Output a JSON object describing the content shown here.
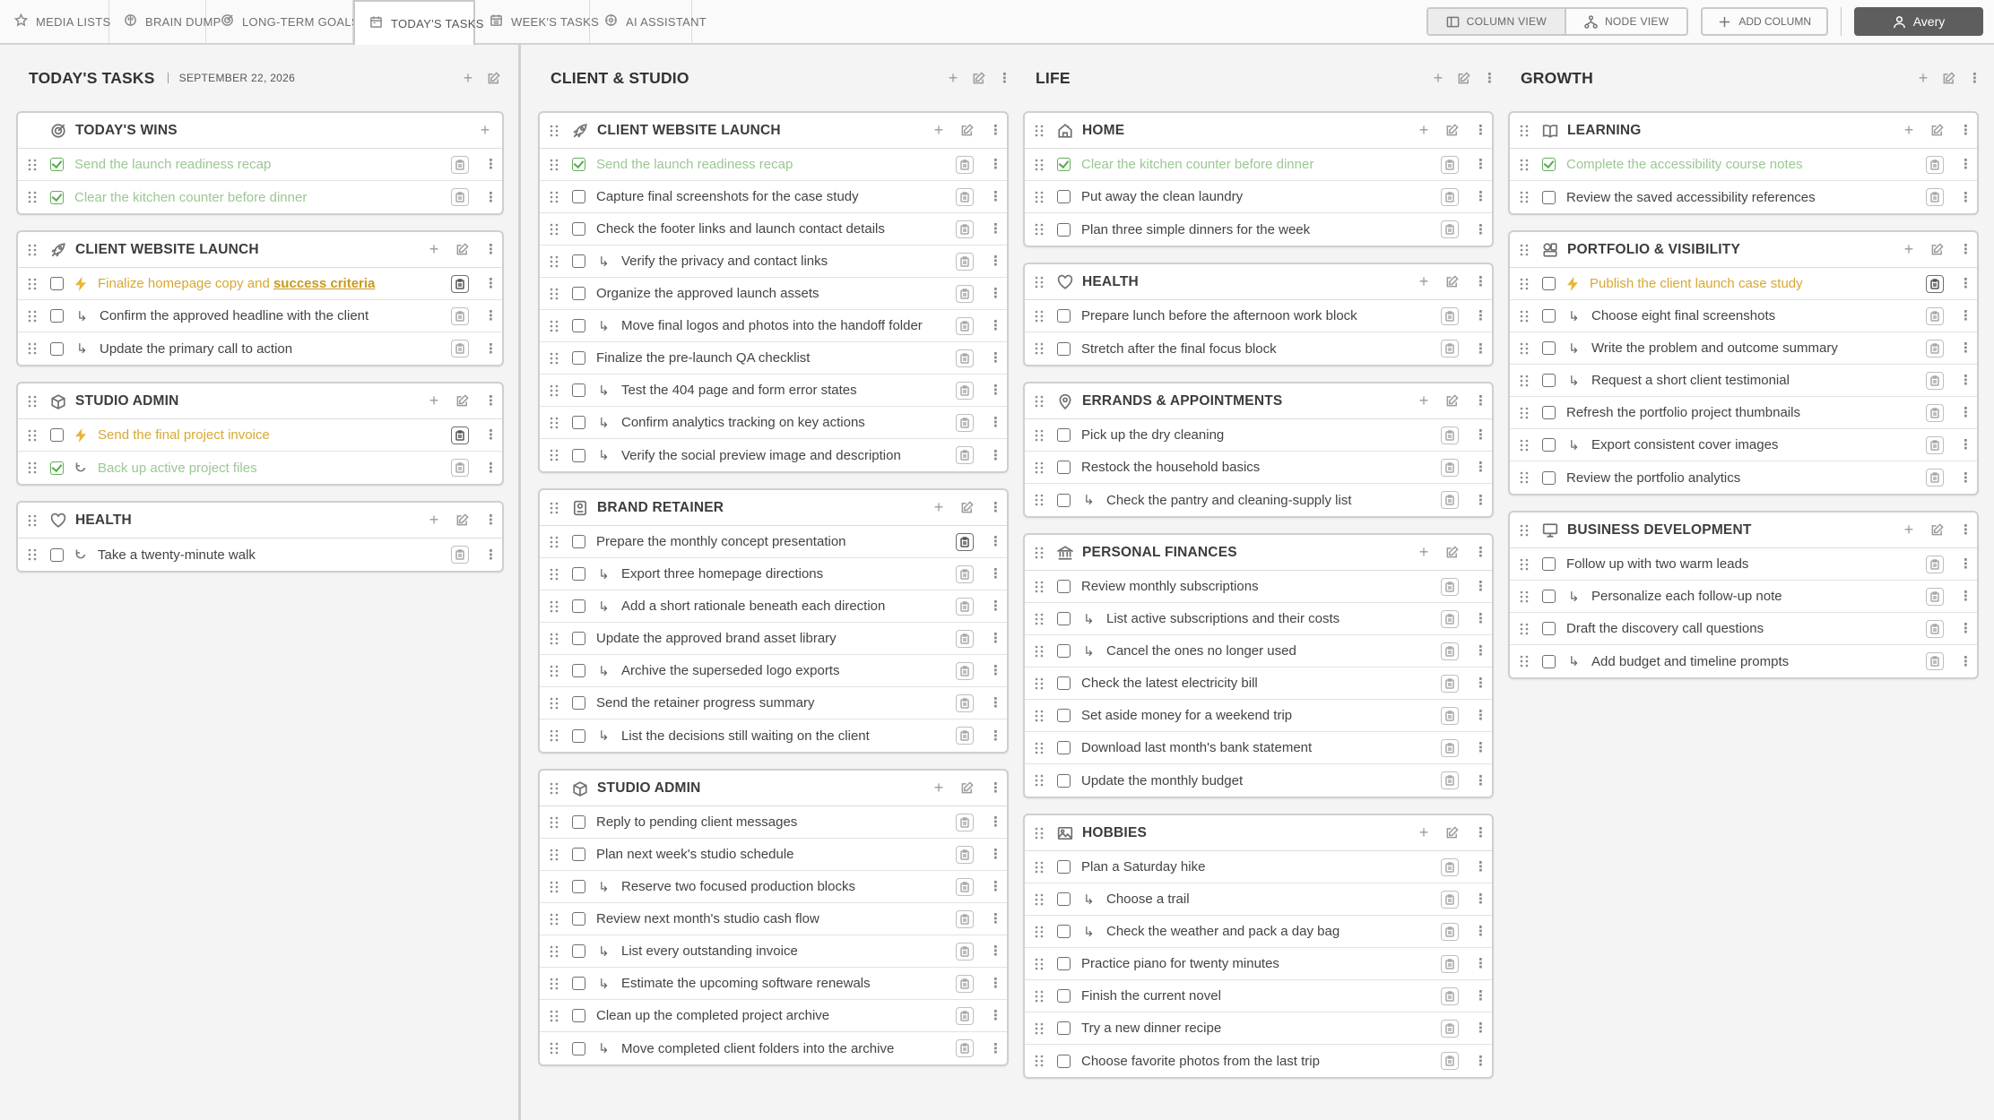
{
  "tabs": [
    {
      "label": "MEDIA LISTS",
      "icon": "star-icon"
    },
    {
      "label": "BRAIN DUMP",
      "icon": "brain-icon"
    },
    {
      "label": "LONG-TERM GOALS",
      "icon": "target-icon"
    },
    {
      "label": "TODAY'S TASKS",
      "icon": "calendar-icon",
      "active": true
    },
    {
      "label": "WEEK'S TASKS",
      "icon": "calendar-week-icon"
    },
    {
      "label": "AI ASSISTANT",
      "icon": "ai-icon"
    }
  ],
  "toolbar": {
    "column_view": "COLUMN VIEW",
    "node_view": "NODE VIEW",
    "add_column": "ADD COLUMN",
    "user": "Avery"
  },
  "colors": {
    "done": "#9bc794",
    "priority": "#d8a833",
    "check": "#5aa851"
  },
  "columns": [
    {
      "title": "TODAY'S TASKS",
      "date": "SEPTEMBER 22, 2026",
      "cards": [
        {
          "title": "TODAY'S WINS",
          "icon": "target-icon",
          "no_grip": true,
          "no_kebab": true,
          "items": [
            {
              "text": "Send the launch readiness recap",
              "done": true
            },
            {
              "text": "Clear the kitchen counter before dinner",
              "done": true
            }
          ]
        },
        {
          "title": "CLIENT WEBSITE LAUNCH",
          "icon": "rocket-icon",
          "items": [
            {
              "text": "Finalize homepage copy and ",
              "emph": "success criteria",
              "priority": true,
              "dark_clip": true
            },
            {
              "text": "Confirm the approved headline with the client",
              "sub": true
            },
            {
              "text": "Update the primary call to action",
              "sub": true
            }
          ]
        },
        {
          "title": "STUDIO ADMIN",
          "icon": "box-icon",
          "items": [
            {
              "text": "Send the final project invoice",
              "priority": true,
              "dark_clip": true
            },
            {
              "text": "Back up active project files",
              "done": true,
              "recurring": true
            }
          ]
        },
        {
          "title": "HEALTH",
          "icon": "heart-icon",
          "items": [
            {
              "text": "Take a twenty-minute walk",
              "recurring": true
            }
          ]
        }
      ]
    },
    {
      "title": "CLIENT & STUDIO",
      "cards": [
        {
          "title": "CLIENT WEBSITE LAUNCH",
          "icon": "rocket-icon",
          "items": [
            {
              "text": "Send the launch readiness recap",
              "done": true
            },
            {
              "text": "Capture final screenshots for the case study"
            },
            {
              "text": "Check the footer links and launch contact details"
            },
            {
              "text": "Verify the privacy and contact links",
              "sub": true
            },
            {
              "text": "Organize the approved launch assets"
            },
            {
              "text": "Move final logos and photos into the handoff folder",
              "sub": true
            },
            {
              "text": "Finalize the pre-launch QA checklist"
            },
            {
              "text": "Test the 404 page and form error states",
              "sub": true
            },
            {
              "text": "Confirm analytics tracking on key actions",
              "sub": true
            },
            {
              "text": "Verify the social preview image and description",
              "sub": true
            }
          ]
        },
        {
          "title": "BRAND RETAINER",
          "icon": "badge-icon",
          "items": [
            {
              "text": "Prepare the monthly concept presentation",
              "dark_clip": true
            },
            {
              "text": "Export three homepage directions",
              "sub": true
            },
            {
              "text": "Add a short rationale beneath each direction",
              "sub": true
            },
            {
              "text": "Update the approved brand asset library"
            },
            {
              "text": "Archive the superseded logo exports",
              "sub": true
            },
            {
              "text": "Send the retainer progress summary"
            },
            {
              "text": "List the decisions still waiting on the client",
              "sub": true
            }
          ]
        },
        {
          "title": "STUDIO ADMIN",
          "icon": "box-icon",
          "items": [
            {
              "text": "Reply to pending client messages"
            },
            {
              "text": "Plan next week's studio schedule"
            },
            {
              "text": "Reserve two focused production blocks",
              "sub": true
            },
            {
              "text": "Review next month's studio cash flow"
            },
            {
              "text": "List every outstanding invoice",
              "sub": true
            },
            {
              "text": "Estimate the upcoming software renewals",
              "sub": true
            },
            {
              "text": "Clean up the completed project archive"
            },
            {
              "text": "Move completed client folders into the archive",
              "sub": true
            }
          ]
        }
      ]
    },
    {
      "title": "LIFE",
      "cards": [
        {
          "title": "HOME",
          "icon": "home-icon",
          "items": [
            {
              "text": "Clear the kitchen counter before dinner",
              "done": true
            },
            {
              "text": "Put away the clean laundry"
            },
            {
              "text": "Plan three simple dinners for the week"
            }
          ]
        },
        {
          "title": "HEALTH",
          "icon": "heart-icon",
          "items": [
            {
              "text": "Prepare lunch before the afternoon work block"
            },
            {
              "text": "Stretch after the final focus block"
            }
          ]
        },
        {
          "title": "ERRANDS & APPOINTMENTS",
          "icon": "pin-icon",
          "items": [
            {
              "text": "Pick up the dry cleaning"
            },
            {
              "text": "Restock the household basics"
            },
            {
              "text": "Check the pantry and cleaning-supply list",
              "sub": true
            }
          ]
        },
        {
          "title": "PERSONAL FINANCES",
          "icon": "bank-icon",
          "items": [
            {
              "text": "Review monthly subscriptions"
            },
            {
              "text": "List active subscriptions and their costs",
              "sub": true
            },
            {
              "text": "Cancel the ones no longer used",
              "sub": true
            },
            {
              "text": "Check the latest electricity bill"
            },
            {
              "text": "Set aside money for a weekend trip"
            },
            {
              "text": "Download last month's bank statement"
            },
            {
              "text": "Update the monthly budget"
            }
          ]
        },
        {
          "title": "HOBBIES",
          "icon": "image-icon",
          "items": [
            {
              "text": "Plan a Saturday hike"
            },
            {
              "text": "Choose a trail",
              "sub": true
            },
            {
              "text": "Check the weather and pack a day bag",
              "sub": true
            },
            {
              "text": "Practice piano for twenty minutes"
            },
            {
              "text": "Finish the current novel"
            },
            {
              "text": "Try a new dinner recipe"
            },
            {
              "text": "Choose favorite photos from the last trip"
            }
          ]
        }
      ]
    },
    {
      "title": "GROWTH",
      "cards": [
        {
          "title": "LEARNING",
          "icon": "book-icon",
          "items": [
            {
              "text": "Complete the accessibility course notes",
              "done": true
            },
            {
              "text": "Review the saved accessibility references"
            }
          ]
        },
        {
          "title": "PORTFOLIO & VISIBILITY",
          "icon": "portfolio-icon",
          "items": [
            {
              "text": "Publish the client launch case study",
              "priority": true,
              "dark_clip": true
            },
            {
              "text": "Choose eight final screenshots",
              "sub": true
            },
            {
              "text": "Write the problem and outcome summary",
              "sub": true
            },
            {
              "text": "Request a short client testimonial",
              "sub": true
            },
            {
              "text": "Refresh the portfolio project thumbnails"
            },
            {
              "text": "Export consistent cover images",
              "sub": true
            },
            {
              "text": "Review the portfolio analytics"
            }
          ]
        },
        {
          "title": "BUSINESS DEVELOPMENT",
          "icon": "presentation-icon",
          "items": [
            {
              "text": "Follow up with two warm leads"
            },
            {
              "text": "Personalize each follow-up note",
              "sub": true
            },
            {
              "text": "Draft the discovery call questions"
            },
            {
              "text": "Add budget and timeline prompts",
              "sub": true
            }
          ]
        }
      ]
    }
  ]
}
